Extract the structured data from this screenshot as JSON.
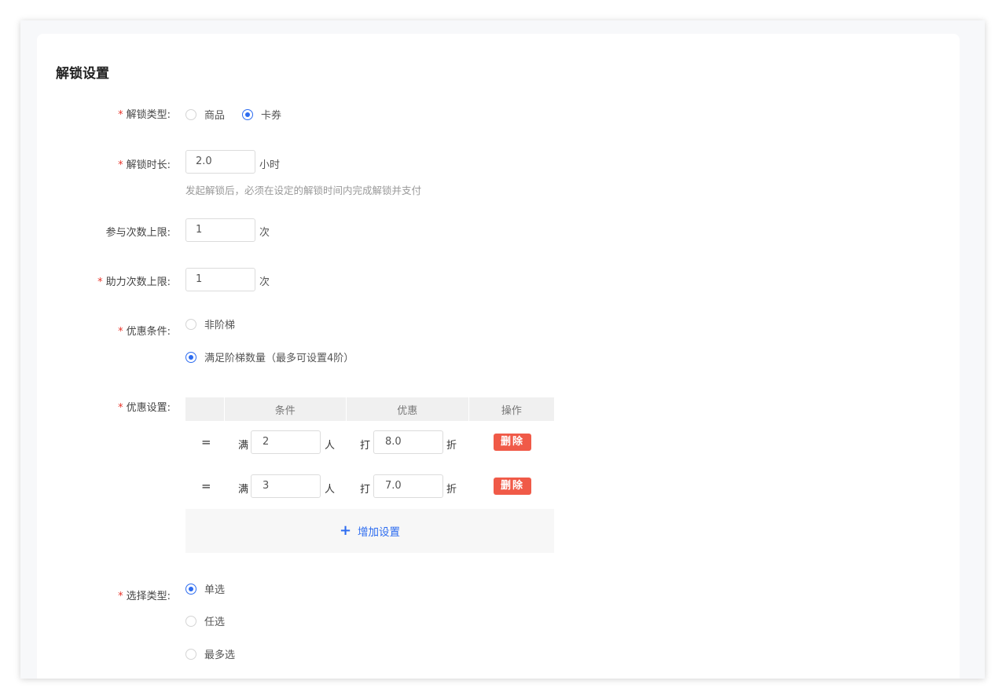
{
  "title": "解锁设置",
  "fields": {
    "unlock_type": {
      "label": "解锁类型:",
      "options": [
        {
          "label": "商品",
          "checked": false
        },
        {
          "label": "卡券",
          "checked": true
        }
      ]
    },
    "unlock_duration": {
      "label": "解锁时长:",
      "value": "2.0",
      "unit": "小时",
      "hint": "发起解锁后，必须在设定的解锁时间内完成解锁并支付"
    },
    "participation_limit": {
      "label": "参与次数上限:",
      "value": "1",
      "unit": "次"
    },
    "assist_limit": {
      "label": "助力次数上限:",
      "value": "1",
      "unit": "次"
    },
    "discount_condition": {
      "label": "优惠条件:",
      "options": [
        {
          "label": "非阶梯",
          "checked": false
        },
        {
          "label": "满足阶梯数量（最多可设置4阶）",
          "checked": true
        }
      ]
    },
    "discount_settings": {
      "label": "优惠设置:",
      "columns": [
        "",
        "条件",
        "优惠",
        "操作"
      ],
      "rows": [
        {
          "op": "=",
          "prefix": "满",
          "count": "2",
          "count_unit": "人",
          "discount_prefix": "打",
          "discount": "8.0",
          "discount_unit": "折",
          "action": "删除"
        },
        {
          "op": "=",
          "prefix": "满",
          "count": "3",
          "count_unit": "人",
          "discount_prefix": "打",
          "discount": "7.0",
          "discount_unit": "折",
          "action": "删除"
        }
      ],
      "add_label": "增加设置"
    },
    "select_type": {
      "label": "选择类型:",
      "options": [
        {
          "label": "单选",
          "checked": true
        },
        {
          "label": "任选",
          "checked": false
        },
        {
          "label": "最多选",
          "checked": false
        }
      ]
    }
  },
  "colors": {
    "accent": "#2d6cf0",
    "required": "#e8342a",
    "delete": "#f05a48"
  }
}
